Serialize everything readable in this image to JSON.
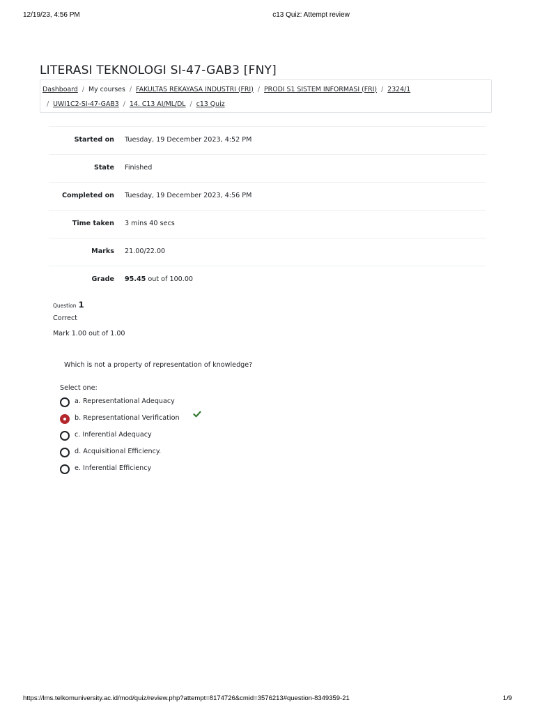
{
  "print": {
    "datetime": "12/19/23, 4:56 PM",
    "document_title": "c13 Quiz: Attempt review",
    "url": "https://lms.telkomuniversity.ac.id/mod/quiz/review.php?attempt=8174726&cmid=3576213#question-8349359-21",
    "page": "1/9"
  },
  "course": {
    "title": "LITERASI TEKNOLOGI SI-47-GAB3 [FNY]"
  },
  "breadcrumb": [
    {
      "label": "Dashboard",
      "link": true
    },
    {
      "label": "My courses",
      "link": false
    },
    {
      "label": "FAKULTAS REKAYASA INDUSTRI (FRI)",
      "link": true
    },
    {
      "label": "PRODI S1 SISTEM INFORMASI (FRI)",
      "link": true
    },
    {
      "label": "2324/1",
      "link": true
    },
    {
      "label": "UWI1C2-SI-47-GAB3",
      "link": true
    },
    {
      "label": "14. C13 AI/ML/DL",
      "link": true
    },
    {
      "label": "c13 Quiz",
      "link": true
    }
  ],
  "breadcrumb_separator": "/",
  "summary": {
    "started_on": {
      "label": "Started on",
      "value": "Tuesday, 19 December 2023, 4:52 PM"
    },
    "state": {
      "label": "State",
      "value": "Finished"
    },
    "completed_on": {
      "label": "Completed on",
      "value": "Tuesday, 19 December 2023, 4:56 PM"
    },
    "time_taken": {
      "label": "Time taken",
      "value": "3 mins 40 secs"
    },
    "marks": {
      "label": "Marks",
      "value": "21.00/22.00"
    },
    "grade": {
      "label": "Grade",
      "value_bold": "95.45",
      "value_rest": " out of 100.00"
    }
  },
  "question": {
    "label": "Question",
    "number": "1",
    "state": "Correct",
    "grade": "Mark 1.00 out of 1.00",
    "text": "Which is not a property of representation of knowledge?",
    "prompt": "Select one:",
    "options": [
      {
        "text": "a. Representational Adequacy",
        "selected": false,
        "correct": false
      },
      {
        "text": "b. Representational Verification",
        "selected": true,
        "correct": true
      },
      {
        "text": "c. Inferential Adequacy",
        "selected": false,
        "correct": false
      },
      {
        "text": "d. Acquisitional Efficiency.",
        "selected": false,
        "correct": false
      },
      {
        "text": "e. Inferential Efficiency",
        "selected": false,
        "correct": false
      }
    ]
  },
  "colors": {
    "selected_radio": "#b3282d",
    "correct_tick": "#357a32",
    "text": "#1d2125",
    "border": "#dee2e6"
  },
  "icons": {
    "correct": "check-icon"
  }
}
